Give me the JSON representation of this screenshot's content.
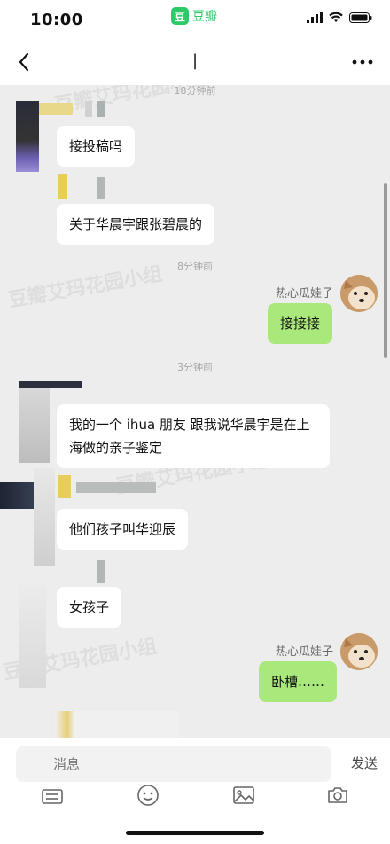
{
  "status_bar": {
    "time": "10:00",
    "app_icon_char": "豆",
    "app_name": "豆瓣",
    "icons": [
      "signal-icon",
      "wifi-icon",
      "battery-icon"
    ]
  },
  "nav": {
    "title": "|",
    "back_icon": "chevron-left-icon",
    "more_icon": "more-dots-icon"
  },
  "watermark": "豆瓣艾玛花园小组",
  "messages": {
    "t1": "18分钟前",
    "m1": "接投稿吗",
    "m2": "关于华晨宇跟张碧晨的",
    "t2": "8分钟前",
    "sender1": "热心瓜娃子",
    "m3": "接接接",
    "t3": "3分钟前",
    "m4": "我的一个 ihua 朋友 跟我说华晨宇是在上海做的亲子鉴定",
    "m5": "他们孩子叫华迎辰",
    "m6": "女孩子",
    "sender2": "热心瓜娃子",
    "m7": "卧槽……"
  },
  "input": {
    "placeholder": "消息",
    "send_label": "发送",
    "tools": [
      "keyboard-icon",
      "emoji-icon",
      "image-icon",
      "camera-icon"
    ]
  }
}
